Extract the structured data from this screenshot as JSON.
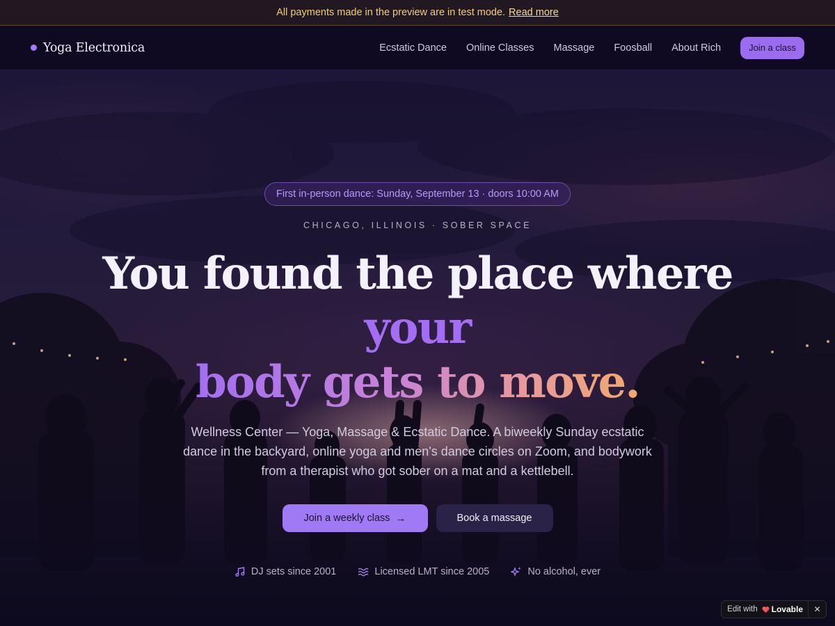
{
  "banner": {
    "message": "All payments made in the preview are in test mode.",
    "link_label": "Read more"
  },
  "nav": {
    "brand": "Yoga Electronica",
    "links": [
      "Ecstatic Dance",
      "Online Classes",
      "Massage",
      "Foosball",
      "About Rich"
    ],
    "cta_label": "Join a class"
  },
  "hero": {
    "announcement": "First in-person dance: Sunday, September 13 · doors 10:00 AM",
    "location": "CHICAGO, ILLINOIS · SOBER SPACE",
    "headline_plain": "You found the place where ",
    "headline_accent": "your",
    "headline_gradient": "body gets to move.",
    "description": "Wellness Center — Yoga, Massage & Ecstatic Dance. A biweekly Sunday ecstatic dance in the backyard, online yoga and men's dance circles on Zoom, and bodywork from a therapist who got sober on a mat and a kettlebell.",
    "primary_cta": "Join a weekly class",
    "secondary_cta": "Book a massage",
    "features": [
      {
        "icon": "music-note-icon",
        "label": "DJ sets since 2001"
      },
      {
        "icon": "waves-icon",
        "label": "Licensed LMT since 2005"
      },
      {
        "icon": "sparkles-icon",
        "label": "No alcohol, ever"
      }
    ]
  },
  "badge": {
    "prefix": "Edit with",
    "brand": "Lovable",
    "close_icon": "close-icon"
  },
  "colors": {
    "accent": "#a07af5",
    "background": "#0d0a1f",
    "banner_text": "#f0cf74",
    "gradient_start": "#a26ef2",
    "gradient_end": "#f0aa6c"
  }
}
